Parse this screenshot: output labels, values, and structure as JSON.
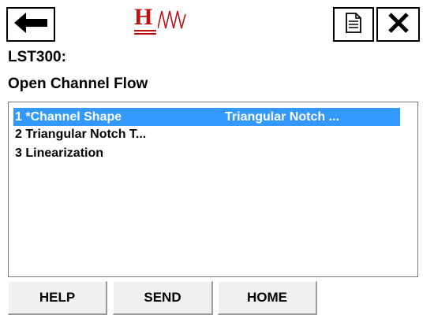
{
  "header": {
    "logo_text": "H",
    "back_icon": "arrow-left",
    "document_icon": "document",
    "close_icon": "close-x"
  },
  "device_title": "LST300:",
  "section_title": "Open Channel Flow",
  "menu": {
    "items": [
      {
        "label": "1 *Channel Shape",
        "value": "Triangular Notch ...",
        "selected": true
      },
      {
        "label": "2 Triangular Notch T...",
        "value": "",
        "selected": false
      },
      {
        "label": "3 Linearization",
        "value": "",
        "selected": false
      }
    ]
  },
  "buttons": {
    "help": "HELP",
    "send": "SEND",
    "home": "HOME"
  },
  "colors": {
    "selection": "#3399ff",
    "logo": "#c01010",
    "button_face": "#f0f0f0"
  }
}
